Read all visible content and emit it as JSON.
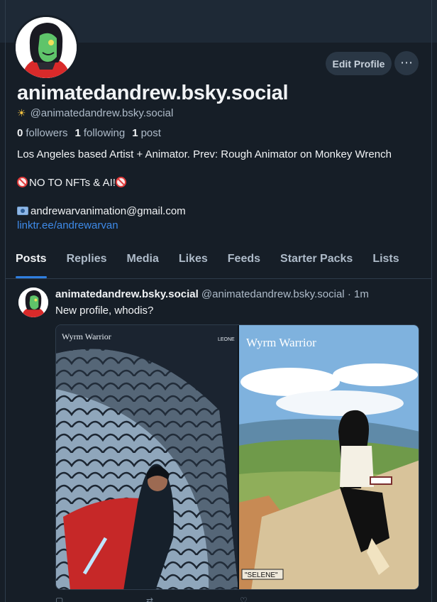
{
  "profile": {
    "display_name": "animatedandrew.bsky.social",
    "handle": "@animatedandrew.bsky.social",
    "handle_icon": "sun-icon",
    "edit_label": "Edit Profile",
    "more_label": "⋯",
    "followers_count": "0",
    "followers_label": "followers",
    "following_count": "1",
    "following_label": "following",
    "posts_count": "1",
    "posts_label": "post",
    "bio": {
      "line1": "Los Angeles based Artist + Animator. Prev: Rough Animator on Monkey Wrench",
      "line2": "NO TO NFTs & AI!",
      "email": "andrewarvanimation@gmail.com",
      "link": "linktr.ee/andrewarvan"
    }
  },
  "tabs": [
    "Posts",
    "Replies",
    "Media",
    "Likes",
    "Feeds",
    "Starter Packs",
    "Lists"
  ],
  "active_tab": "Posts",
  "post": {
    "author_name": "animatedandrew.bsky.social",
    "author_handle": "@animatedandrew.bsky.social",
    "time": "· 1m",
    "text": "New profile, whodis?",
    "image": {
      "left_title": "Wyrm Warrior",
      "left_corner_label": "LEONE",
      "right_title": "Wyrm Warrior",
      "right_caption": "\"SELENE\""
    }
  },
  "colors": {
    "background": "#161e27",
    "banner": "#1e2936",
    "accent": "#2f7fe0",
    "link": "#3e8ae8"
  }
}
